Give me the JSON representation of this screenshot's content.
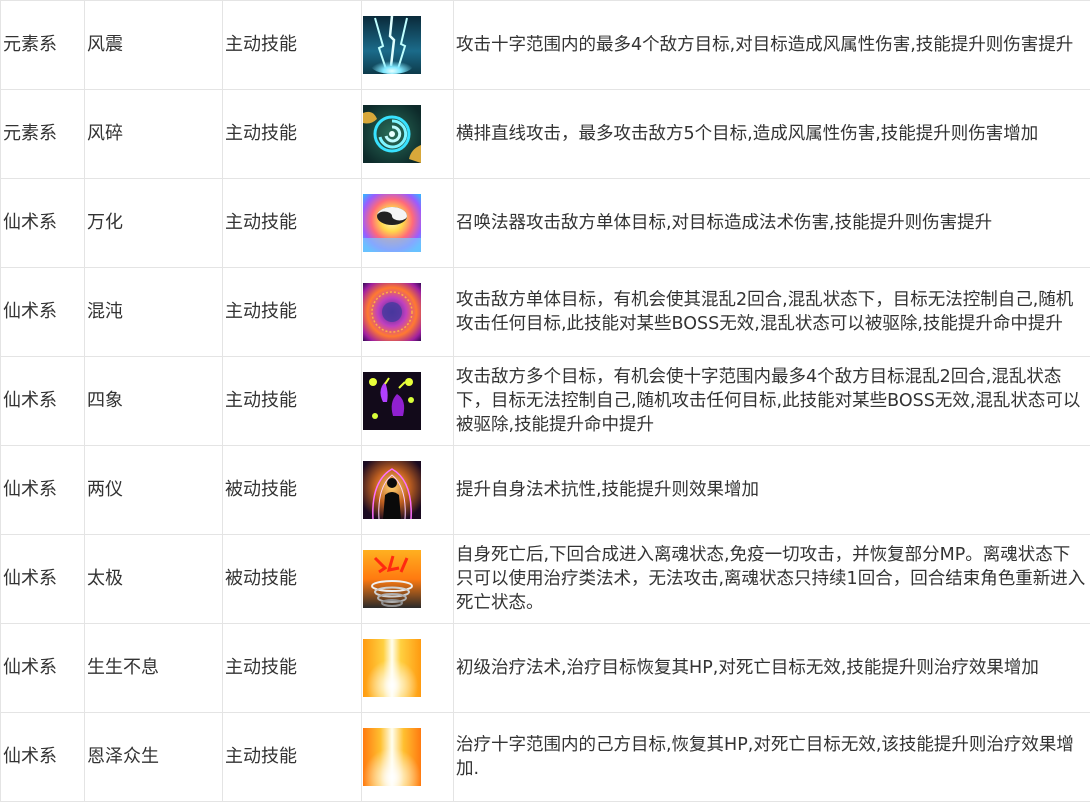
{
  "rows": [
    {
      "school": "元素系",
      "name": "风震",
      "type": "主动技能",
      "icon": "wind-quake-icon",
      "desc": "攻击十字范围内的最多4个敌方目标,对目标造成风属性伤害,技能提升则伤害提升"
    },
    {
      "school": "元素系",
      "name": "风碎",
      "type": "主动技能",
      "icon": "wind-shatter-icon",
      "desc": "横排直线攻击，最多攻击敌方5个目标,造成风属性伤害,技能提升则伤害增加"
    },
    {
      "school": "仙术系",
      "name": "万化",
      "type": "主动技能",
      "icon": "yin-yang-icon",
      "desc": "召唤法器攻击敌方单体目标,对目标造成法术伤害,技能提升则伤害提升"
    },
    {
      "school": "仙术系",
      "name": "混沌",
      "type": "主动技能",
      "icon": "chaos-orb-icon",
      "desc": "攻击敌方单体目标，有机会使其混乱2回合,混乱状态下，目标无法控制自己,随机攻击任何目标,此技能对某些BOSS无效,混乱状态可以被驱除,技能提升命中提升"
    },
    {
      "school": "仙术系",
      "name": "四象",
      "type": "主动技能",
      "icon": "four-symbols-icon",
      "desc": "攻击敌方多个目标，有机会使十字范围内最多4个敌方目标混乱2回合,混乱状态下，目标无法控制自己,随机攻击任何目标,此技能对某些BOSS无效,混乱状态可以被驱除,技能提升命中提升"
    },
    {
      "school": "仙术系",
      "name": "两仪",
      "type": "被动技能",
      "icon": "aura-figure-icon",
      "desc": "提升自身法术抗性,技能提升则效果增加"
    },
    {
      "school": "仙术系",
      "name": "太极",
      "type": "被动技能",
      "icon": "spirit-vortex-icon",
      "desc": "自身死亡后,下回合成进入离魂状态,免疫一切攻击，并恢复部分MP。离魂状态下只可以使用治疗类法术，无法攻击,离魂状态只持续1回合，回合结束角色重新进入死亡状态。"
    },
    {
      "school": "仙术系",
      "name": "生生不息",
      "type": "主动技能",
      "icon": "heal-light-icon",
      "desc": "初级治疗法术,治疗目标恢复其HP,对死亡目标无效,技能提升则治疗效果增加"
    },
    {
      "school": "仙术系",
      "name": "恩泽众生",
      "type": "主动技能",
      "icon": "mass-heal-light-icon",
      "desc": "治疗十字范围内的己方目标,恢复其HP,对死亡目标无效,该技能提升则治疗效果增加."
    }
  ]
}
